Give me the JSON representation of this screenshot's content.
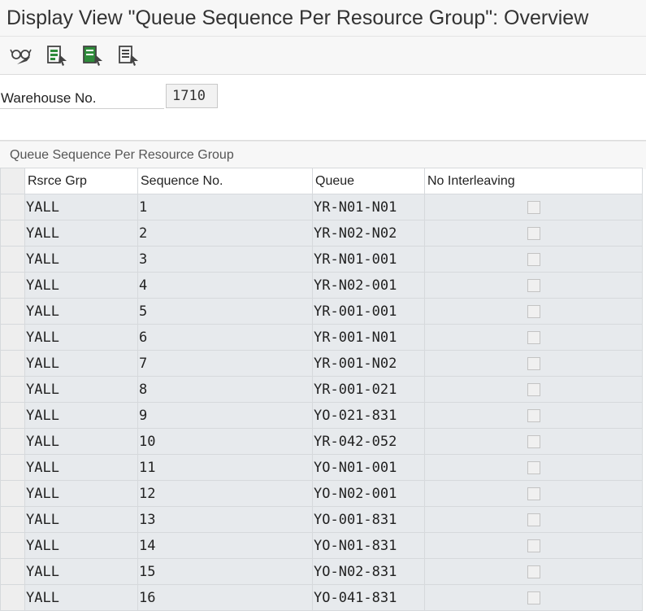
{
  "window": {
    "title": "Display View \"Queue Sequence Per Resource Group\": Overview"
  },
  "toolbar": {
    "buttons": [
      {
        "name": "display-change-toggle-icon"
      },
      {
        "name": "select-all-icon"
      },
      {
        "name": "select-block-icon"
      },
      {
        "name": "deselect-all-icon"
      }
    ]
  },
  "form": {
    "warehouse_label": "Warehouse No.",
    "warehouse_value": "1710"
  },
  "section": {
    "title": "Queue Sequence Per Resource Group"
  },
  "table": {
    "columns": [
      "Rsrce Grp",
      "Sequence No.",
      "Queue",
      "No Interleaving"
    ],
    "rows": [
      {
        "grp": "YALL",
        "seq": "1",
        "queue": "YR-N01-N01",
        "no_interleaving": false
      },
      {
        "grp": "YALL",
        "seq": "2",
        "queue": "YR-N02-N02",
        "no_interleaving": false
      },
      {
        "grp": "YALL",
        "seq": "3",
        "queue": "YR-N01-001",
        "no_interleaving": false
      },
      {
        "grp": "YALL",
        "seq": "4",
        "queue": "YR-N02-001",
        "no_interleaving": false
      },
      {
        "grp": "YALL",
        "seq": "5",
        "queue": "YR-001-001",
        "no_interleaving": false
      },
      {
        "grp": "YALL",
        "seq": "6",
        "queue": "YR-001-N01",
        "no_interleaving": false
      },
      {
        "grp": "YALL",
        "seq": "7",
        "queue": "YR-001-N02",
        "no_interleaving": false
      },
      {
        "grp": "YALL",
        "seq": "8",
        "queue": "YR-001-021",
        "no_interleaving": false
      },
      {
        "grp": "YALL",
        "seq": "9",
        "queue": "YO-021-831",
        "no_interleaving": false
      },
      {
        "grp": "YALL",
        "seq": "10",
        "queue": "YR-042-052",
        "no_interleaving": false
      },
      {
        "grp": "YALL",
        "seq": "11",
        "queue": "YO-N01-001",
        "no_interleaving": false
      },
      {
        "grp": "YALL",
        "seq": "12",
        "queue": "YO-N02-001",
        "no_interleaving": false
      },
      {
        "grp": "YALL",
        "seq": "13",
        "queue": "YO-001-831",
        "no_interleaving": false
      },
      {
        "grp": "YALL",
        "seq": "14",
        "queue": "YO-N01-831",
        "no_interleaving": false
      },
      {
        "grp": "YALL",
        "seq": "15",
        "queue": "YO-N02-831",
        "no_interleaving": false
      },
      {
        "grp": "YALL",
        "seq": "16",
        "queue": "YO-041-831",
        "no_interleaving": false
      }
    ]
  },
  "colors": {
    "cell_bg": "#e7eaed",
    "icon_green": "#2e8b3a"
  }
}
